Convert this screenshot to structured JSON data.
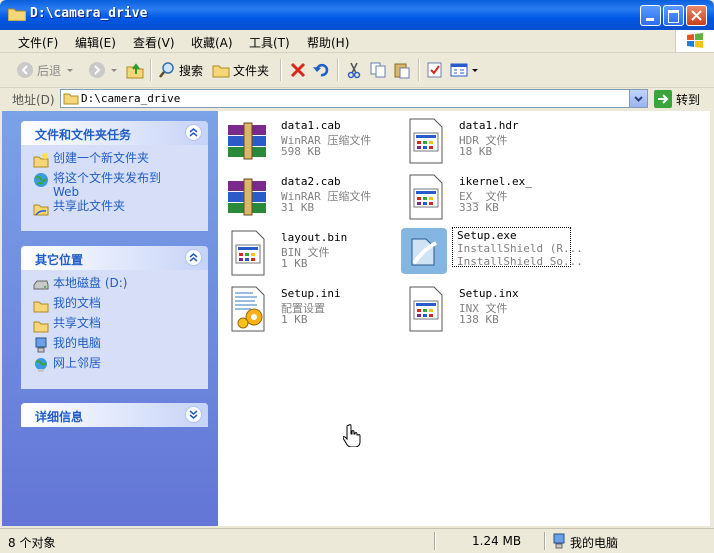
{
  "window": {
    "title": "D:\\camera_drive"
  },
  "menu": [
    "文件(F)",
    "编辑(E)",
    "查看(V)",
    "收藏(A)",
    "工具(T)",
    "帮助(H)"
  ],
  "toolbar": {
    "back": "后退",
    "search": "搜索",
    "folders": "文件夹"
  },
  "address": {
    "label": "地址(D)",
    "value": "D:\\camera_drive",
    "go": "转到"
  },
  "panels": {
    "tasks": {
      "title": "文件和文件夹任务",
      "items": [
        "创建一个新文件夹",
        "将这个文件夹发布到",
        "Web",
        "共享此文件夹"
      ]
    },
    "places": {
      "title": "其它位置",
      "items": [
        "本地磁盘 (D:)",
        "我的文档",
        "共享文档",
        "我的电脑",
        "网上邻居"
      ]
    },
    "details": {
      "title": "详细信息"
    }
  },
  "files": [
    {
      "name": "data1.cab",
      "type": "WinRAR 压缩文件",
      "size": "598 KB",
      "icon": "winrar-archive-icon"
    },
    {
      "name": "data1.hdr",
      "type": "HDR 文件",
      "size": "18 KB",
      "icon": "generic-file-icon"
    },
    {
      "name": "data2.cab",
      "type": "WinRAR 压缩文件",
      "size": "31 KB",
      "icon": "winrar-archive-icon"
    },
    {
      "name": "ikernel.ex_",
      "type": "EX_ 文件",
      "size": "333 KB",
      "icon": "generic-file-icon"
    },
    {
      "name": "layout.bin",
      "type": "BIN 文件",
      "size": "1 KB",
      "icon": "generic-file-icon"
    },
    {
      "name": "Setup.exe",
      "type": "InstallShield (R...",
      "size": "InstallShield So...",
      "icon": "installshield-setup-icon"
    },
    {
      "name": "Setup.ini",
      "type": "配置设置",
      "size": "1 KB",
      "icon": "config-settings-icon"
    },
    {
      "name": "Setup.inx",
      "type": "INX 文件",
      "size": "138 KB",
      "icon": "generic-file-icon"
    }
  ],
  "status": {
    "count": "8 个对象",
    "size": "1.24 MB",
    "location": "我的电脑"
  }
}
